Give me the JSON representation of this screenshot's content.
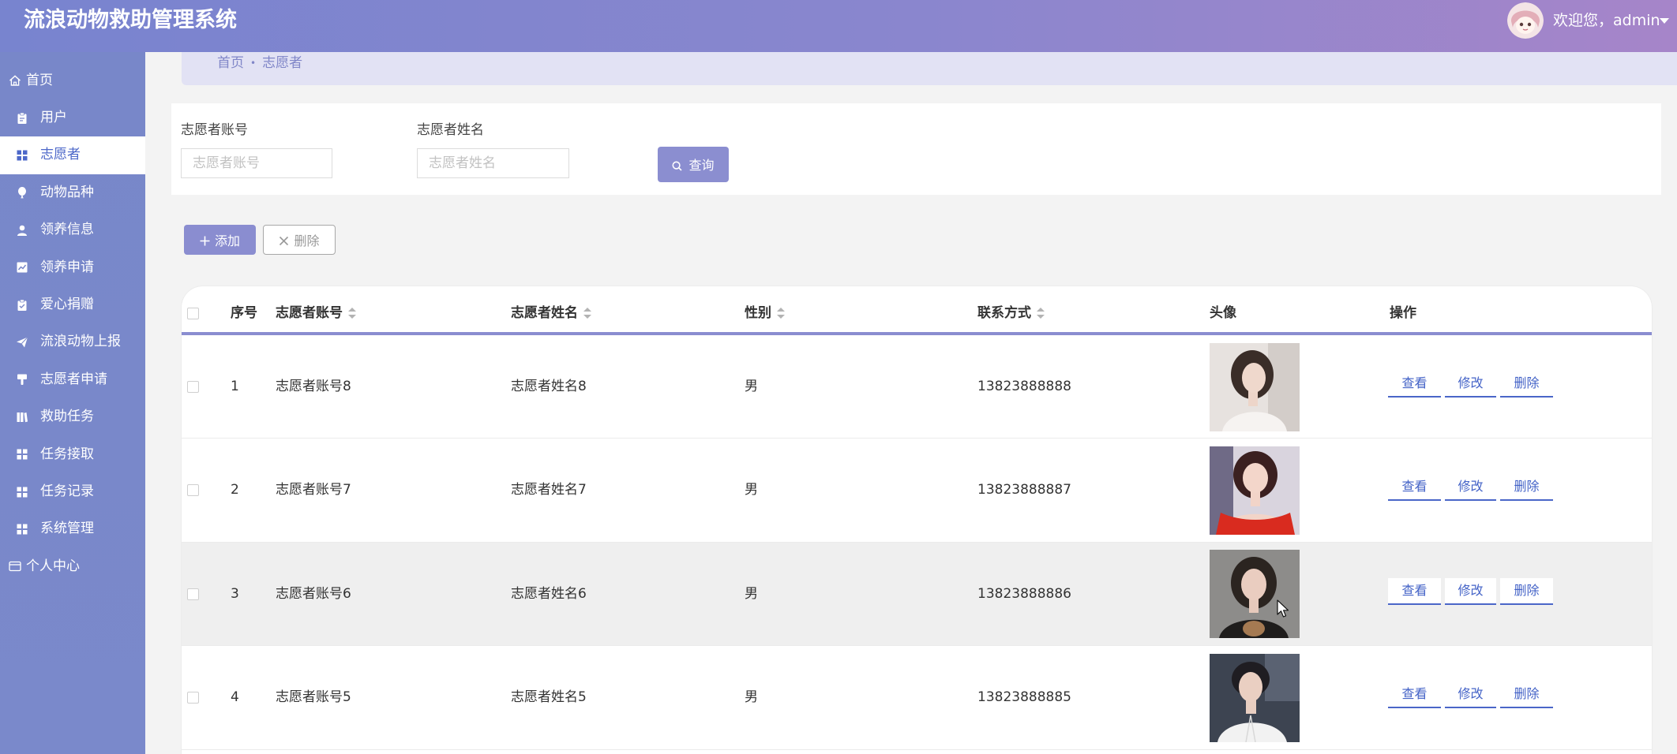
{
  "app": {
    "title": "流浪动物救助管理系统"
  },
  "header": {
    "welcome": "欢迎您，admin",
    "avatar_icon": "user-avatar",
    "dropdown_icon": "caret-down-icon"
  },
  "sidebar": {
    "active_index": 2,
    "items": [
      {
        "label": "首页",
        "icon": "home-icon"
      },
      {
        "label": "用户",
        "icon": "clipboard-icon"
      },
      {
        "label": "志愿者",
        "icon": "grid-icon"
      },
      {
        "label": "动物品种",
        "icon": "balloon-icon"
      },
      {
        "label": "领养信息",
        "icon": "person-icon"
      },
      {
        "label": "领养申请",
        "icon": "chart-icon"
      },
      {
        "label": "爱心捐赠",
        "icon": "clipboard-check-icon"
      },
      {
        "label": "流浪动物上报",
        "icon": "paper-plane-icon"
      },
      {
        "label": "志愿者申请",
        "icon": "paint-roller-icon"
      },
      {
        "label": "救助任务",
        "icon": "book-icon"
      },
      {
        "label": "任务接取",
        "icon": "grid-icon"
      },
      {
        "label": "任务记录",
        "icon": "grid-icon"
      },
      {
        "label": "系统管理",
        "icon": "grid-icon"
      },
      {
        "label": "个人中心",
        "icon": "id-card-icon"
      }
    ]
  },
  "breadcrumb": {
    "home": "首页",
    "separator": "•",
    "current": "志愿者"
  },
  "search": {
    "account": {
      "label": "志愿者账号",
      "placeholder": "志愿者账号",
      "value": ""
    },
    "name": {
      "label": "志愿者姓名",
      "placeholder": "志愿者姓名",
      "value": ""
    },
    "query_label": "查询",
    "query_icon": "search-icon"
  },
  "toolbar": {
    "add_label": "添加",
    "add_icon": "plus-icon",
    "delete_label": "删除",
    "delete_icon": "close-icon"
  },
  "table": {
    "columns": [
      "序号",
      "志愿者账号",
      "志愿者姓名",
      "性别",
      "联系方式",
      "头像",
      "操作"
    ],
    "sort_icon": "sort-icon",
    "hovered_row_index": 2,
    "rows": [
      {
        "index": "1",
        "account": "志愿者账号8",
        "name": "志愿者姓名8",
        "gender": "男",
        "phone": "13823888888"
      },
      {
        "index": "2",
        "account": "志愿者账号7",
        "name": "志愿者姓名7",
        "gender": "男",
        "phone": "13823888887"
      },
      {
        "index": "3",
        "account": "志愿者账号6",
        "name": "志愿者姓名6",
        "gender": "男",
        "phone": "13823888886"
      },
      {
        "index": "4",
        "account": "志愿者账号5",
        "name": "志愿者姓名5",
        "gender": "男",
        "phone": "13823888885"
      }
    ],
    "actions": {
      "view": "查看",
      "edit": "修改",
      "delete": "删除"
    }
  },
  "colors": {
    "header_gradient_start": "#7884cf",
    "header_gradient_end": "#a685c9",
    "sidebar_bg": "#7a88c9",
    "sidebar_active_text": "#4d68c9",
    "accent": "#8a8dd0",
    "breadcrumb_bg": "#e2e2f4",
    "breadcrumb_text": "#8086c8",
    "action_link": "#4463c7",
    "hover_row_bg": "#efefef"
  }
}
